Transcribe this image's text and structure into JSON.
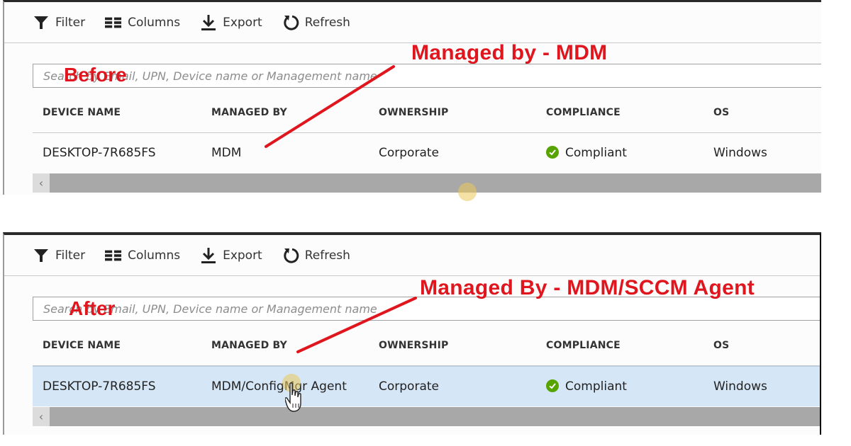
{
  "toolbar": {
    "filter": "Filter",
    "columns": "Columns",
    "export": "Export",
    "refresh": "Refresh"
  },
  "search": {
    "placeholder": "Search by Email, UPN, Device name or Management name"
  },
  "columns": [
    "DEVICE NAME",
    "MANAGED BY",
    "OWNERSHIP",
    "COMPLIANCE",
    "OS"
  ],
  "before": {
    "label": "Before",
    "annotation": "Managed by - MDM",
    "row": {
      "device_name": "DESKTOP-7R685FS",
      "managed_by": "MDM",
      "ownership": "Corporate",
      "compliance": "Compliant",
      "os": "Windows"
    }
  },
  "after": {
    "label": "After",
    "annotation": "Managed By - MDM/SCCM Agent",
    "row": {
      "device_name": "DESKTOP-7R685FS",
      "managed_by": "MDM/ConfigMgr Agent",
      "ownership": "Corporate",
      "compliance": "Compliant",
      "os": "Windows"
    }
  },
  "icons": {
    "filter": "filter-funnel-icon",
    "columns": "columns-icon",
    "export": "download-icon",
    "refresh": "refresh-icon",
    "compliant": "check-circle-icon",
    "scroll_left": "chevron-left-icon"
  },
  "colors": {
    "annotation": "#e0161e",
    "compliant": "#57a300",
    "selected_row": "#d5e6f7",
    "scrollbar": "#a8a8a8"
  }
}
